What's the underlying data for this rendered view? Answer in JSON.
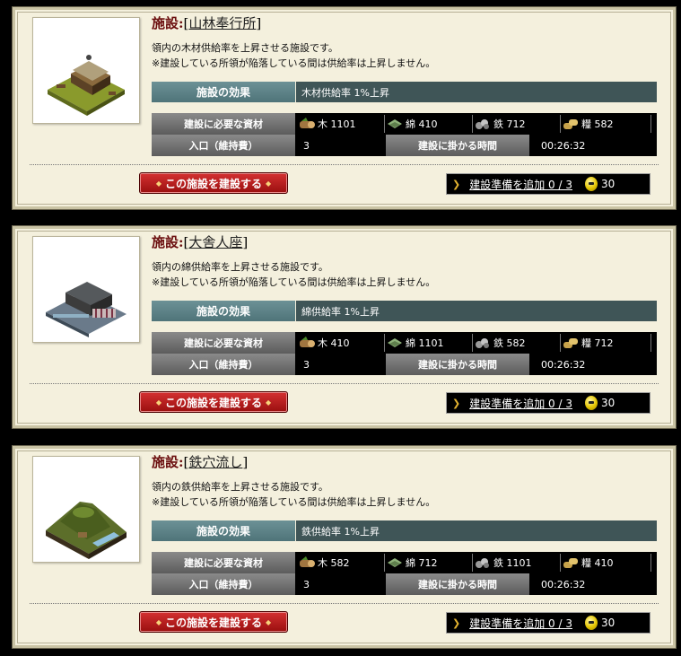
{
  "common": {
    "facility_label": "施設:",
    "effect_header": "施設の効果",
    "resources_header": "建設に必要な資材",
    "population_header": "入口（維持費）",
    "time_header": "建設に掛かる時間",
    "build_button_label": "この施設を建設する",
    "queue_label": "建設準備を追加 0 / 3",
    "coin_cost": "30",
    "warning_text": "※建設している所領が陥落している間は供給率は上昇しません。",
    "colors": {
      "title_red": "#6a0d0d",
      "effect_teal": "#4f7479",
      "button_red": "#b41e1e",
      "card_bg": "#f4f0dd"
    }
  },
  "facilities": [
    {
      "name": "山林奉行所",
      "description": "領内の木材供給率を上昇させる施設です。",
      "effect": "木材供給率 1%上昇",
      "resources": [
        {
          "icon": "wood-icon",
          "label": "木",
          "amount": "1101"
        },
        {
          "icon": "cotton-icon",
          "label": "綿",
          "amount": "410"
        },
        {
          "icon": "iron-icon",
          "label": "鉄",
          "amount": "712"
        },
        {
          "icon": "food-icon",
          "label": "糧",
          "amount": "582"
        }
      ],
      "population": "3",
      "build_time": "00:26:32"
    },
    {
      "name": "大舎人座",
      "description": "領内の綿供給率を上昇させる施設です。",
      "effect": "綿供給率 1%上昇",
      "resources": [
        {
          "icon": "wood-icon",
          "label": "木",
          "amount": "410"
        },
        {
          "icon": "cotton-icon",
          "label": "綿",
          "amount": "1101"
        },
        {
          "icon": "iron-icon",
          "label": "鉄",
          "amount": "582"
        },
        {
          "icon": "food-icon",
          "label": "糧",
          "amount": "712"
        }
      ],
      "population": "3",
      "build_time": "00:26:32"
    },
    {
      "name": "鉄穴流し",
      "description": "領内の鉄供給率を上昇させる施設です。",
      "effect": "鉄供給率 1%上昇",
      "resources": [
        {
          "icon": "wood-icon",
          "label": "木",
          "amount": "582"
        },
        {
          "icon": "cotton-icon",
          "label": "綿",
          "amount": "712"
        },
        {
          "icon": "iron-icon",
          "label": "鉄",
          "amount": "1101"
        },
        {
          "icon": "food-icon",
          "label": "糧",
          "amount": "410"
        }
      ],
      "population": "3",
      "build_time": "00:26:32"
    }
  ]
}
